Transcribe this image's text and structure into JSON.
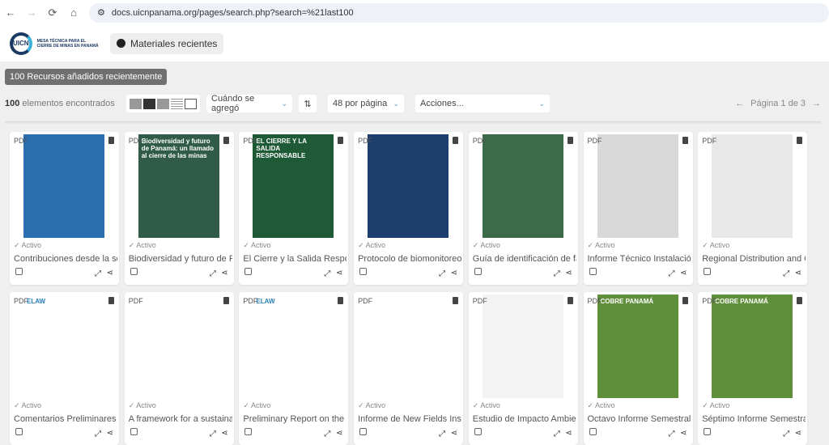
{
  "browser": {
    "url": "docs.uicnpanama.org/pages/search.php?search=%21last100"
  },
  "header": {
    "logo_text": "UICN",
    "logo_subtitle": "MESA TÉCNICA PARA EL CIERRE DE MINAS EN PANAMÁ",
    "recent_button": "Materiales recientes"
  },
  "banner": "100 Recursos añadidos recientemente",
  "toolbar": {
    "count": "100",
    "count_label": "elementos encontrados",
    "sort": "Cuándo se agregó",
    "per_page": "48 por página",
    "actions": "Acciones...",
    "page": "Página 1 de 3"
  },
  "colors": {
    "accent": "#5aa0c8",
    "banner": "#707070"
  },
  "cards": [
    {
      "type": "PDF",
      "status": "Activo",
      "title": "Contribuciones desde la sociedad",
      "thumb": "#2a6fb0"
    },
    {
      "type": "PDF",
      "status": "Activo",
      "title": "Biodiversidad y futuro de Panamá",
      "thumb": "#2f5b48"
    },
    {
      "type": "PDF",
      "status": "Activo",
      "title": "El Cierre y la Salida Responsable",
      "thumb": "#1f5a36"
    },
    {
      "type": "PDF",
      "status": "Activo",
      "title": "Protocolo de biomonitoreo",
      "thumb": "#1d3f6e"
    },
    {
      "type": "PDF",
      "status": "Activo",
      "title": "Guía de identificación de familias",
      "thumb": "#3c6b4a"
    },
    {
      "type": "PDF",
      "status": "Activo",
      "title": "Informe Técnico Instalación",
      "thumb": "#d9d9d9"
    },
    {
      "type": "PDF",
      "status": "Activo",
      "title": "Regional Distribution and Causes",
      "thumb": "#e8e8e8"
    },
    {
      "type": "PDF",
      "status": "Activo",
      "title": "Comentarios Preliminares",
      "thumb": "#ffffff"
    },
    {
      "type": "PDF",
      "status": "Activo",
      "title": "A framework for a sustainable",
      "thumb": "#ffffff"
    },
    {
      "type": "PDF",
      "status": "Activo",
      "title": "Preliminary Report on the",
      "thumb": "#ffffff"
    },
    {
      "type": "PDF",
      "status": "Activo",
      "title": "Informe de New Fields Inspección",
      "thumb": "#ffffff"
    },
    {
      "type": "PDF",
      "status": "Activo",
      "title": "Estudio de Impacto Ambiental",
      "thumb": "#f3f3f3"
    },
    {
      "type": "PDF",
      "status": "Activo",
      "title": "Octavo Informe Semestral",
      "thumb": "#5f8f3a"
    },
    {
      "type": "PDF",
      "status": "Activo",
      "title": "Séptimo Informe Semestral",
      "thumb": "#5f8f3a"
    }
  ],
  "thumb_texts": {
    "c2": "Biodiversidad y futuro de Panamá: un llamado al cierre de las minas",
    "c3": "EL CIERRE Y LA SALIDA RESPONSABLE",
    "c13": "COBRE PANAMÁ",
    "c14": "COBRE PANAMÁ",
    "elaw": "ELAW"
  }
}
